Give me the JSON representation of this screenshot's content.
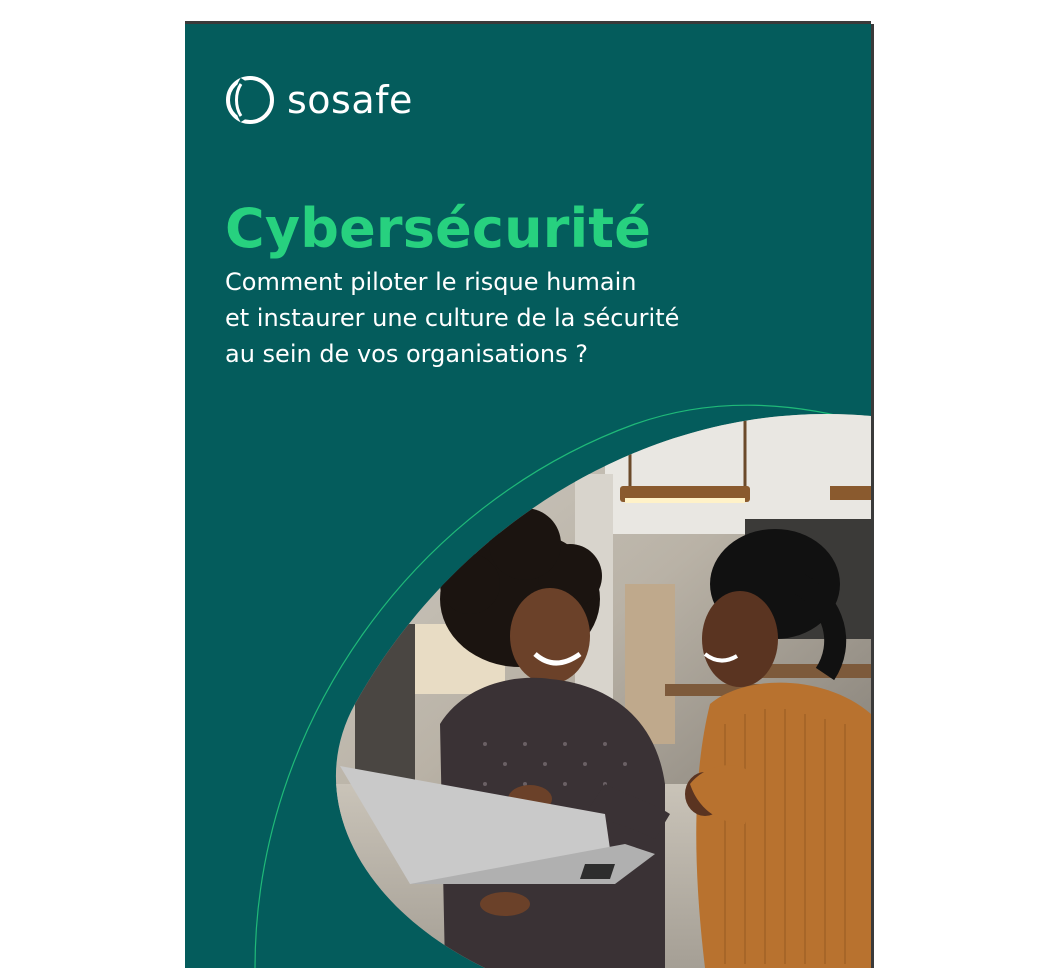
{
  "brand": {
    "name": "sosafe",
    "logo_icon": "sosafe-logo-mark",
    "colors": {
      "background": "#045c5c",
      "accent": "#27d17f",
      "text": "#ffffff"
    }
  },
  "cover": {
    "title": "Cybersécurité",
    "subtitle_lines": [
      "Comment piloter le risque humain",
      "et instaurer une culture de la sécurité",
      "au sein de vos organisations ?"
    ]
  }
}
